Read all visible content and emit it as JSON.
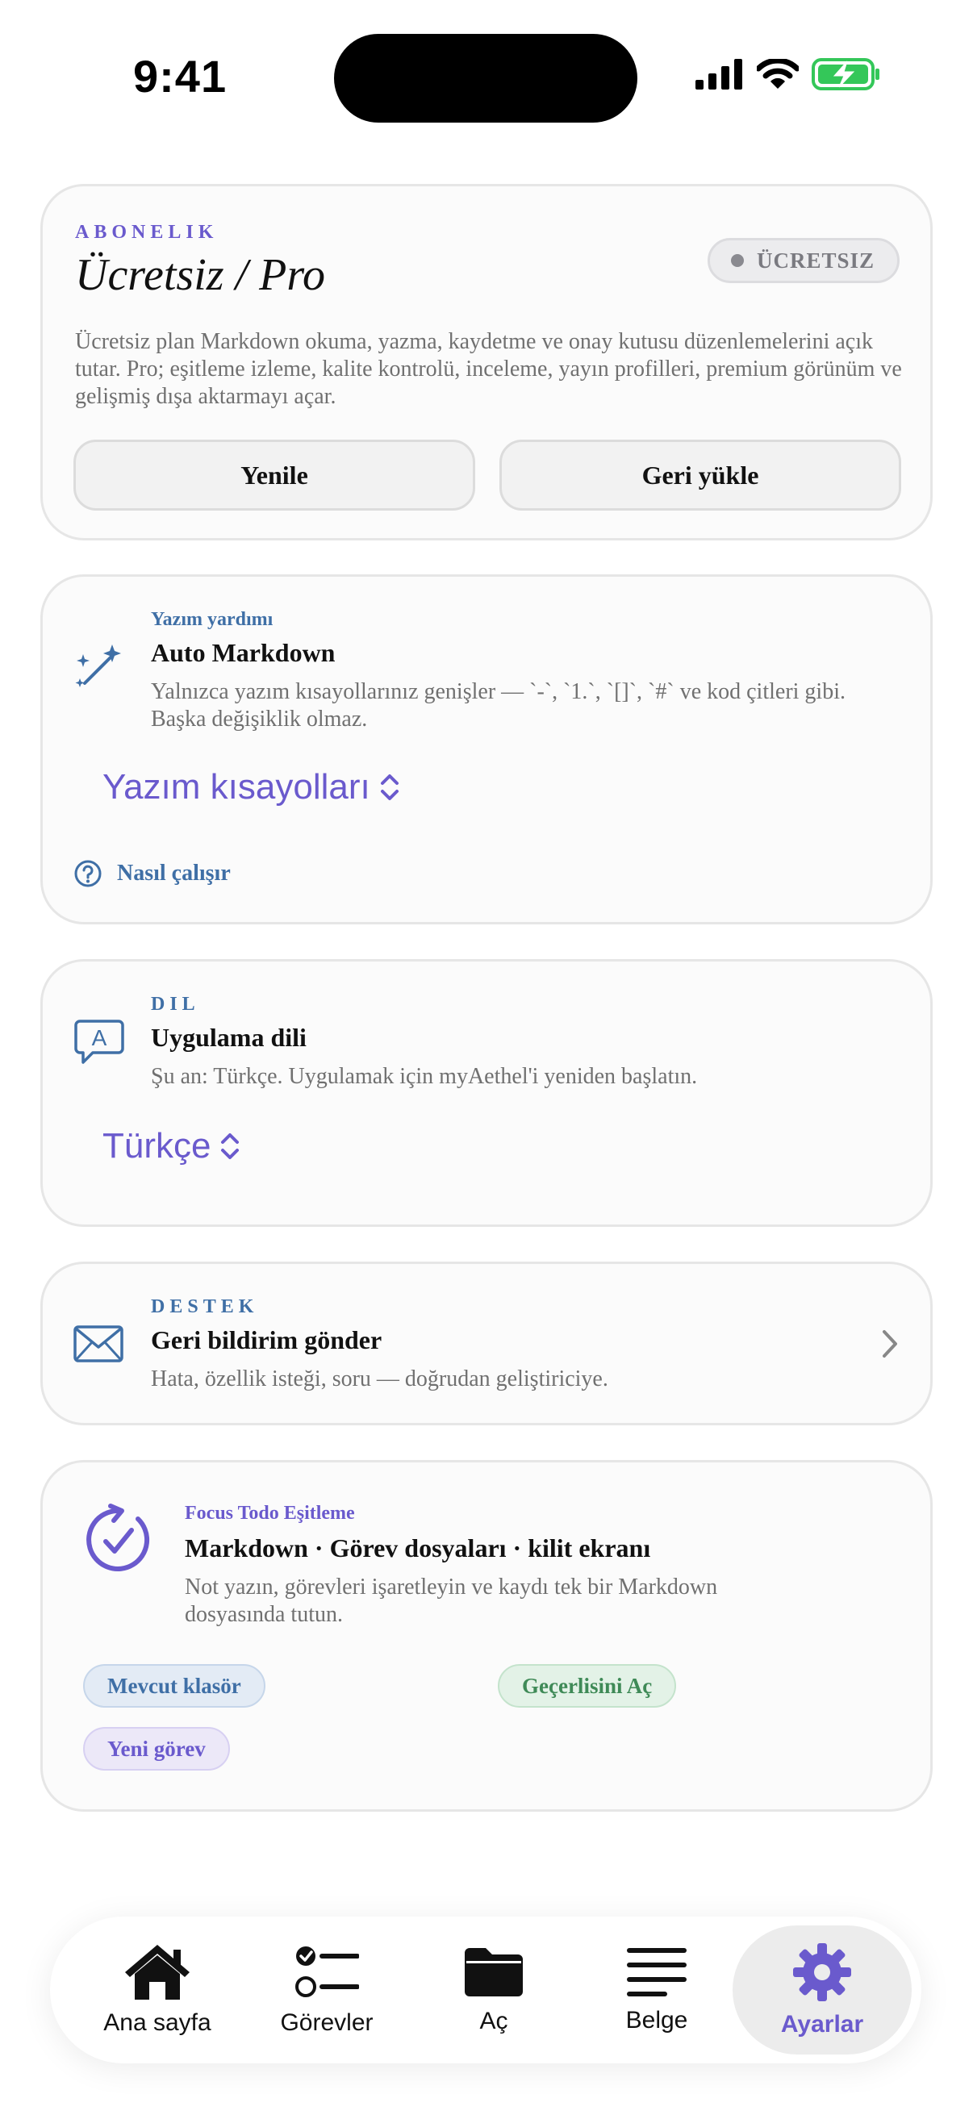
{
  "status_bar": {
    "time": "9:41",
    "icons": [
      "cellular-signal-icon",
      "wifi-icon",
      "battery-charging-icon"
    ]
  },
  "subscription": {
    "overline": "ABONELIK",
    "title": "Ücretsiz / Pro",
    "badge": "ÜCRETSIZ",
    "description": "Ücretsiz plan Markdown okuma, yazma, kaydetme ve onay kutusu düzenlemelerini açık tutar. Pro; eşitleme izleme, kalite kontrolü, inceleme, yayın profilleri, premium görünüm ve gelişmiş dışa aktarmayı açar.",
    "refresh_label": "Yenile",
    "restore_label": "Geri yükle"
  },
  "writing_assist": {
    "overline": "Yazım yardımı",
    "title": "Auto Markdown",
    "description": "Yalnızca yazım kısayollarınız genişler — `-`, `1.`, `[]`, `#` ve kod çitleri gibi. Başka değişiklik olmaz.",
    "picker_label": "Yazım kısayolları",
    "help_label": "Nasıl çalışır"
  },
  "language": {
    "overline": "DIL",
    "title": "Uygulama dili",
    "description": "Şu an: Türkçe. Uygulamak için myAethel'i yeniden başlatın.",
    "picker_label": "Türkçe"
  },
  "support": {
    "overline": "DESTEK",
    "title": "Geri bildirim gönder",
    "description": "Hata, özellik isteği, soru — doğrudan geliştiriciye."
  },
  "focus_todo": {
    "overline": "Focus Todo Eşitleme",
    "title": "Markdown · Görev dosyaları · kilit ekranı",
    "description": "Not yazın, görevleri işaretleyin ve kaydı tek bir Markdown dosyasında tutun.",
    "chips": [
      "Mevcut klasör",
      "Geçerlisini Aç",
      "Yeni görev"
    ]
  },
  "tabbar": {
    "tabs": [
      {
        "label": "Ana sayfa",
        "icon": "home-icon"
      },
      {
        "label": "Görevler",
        "icon": "checklist-icon"
      },
      {
        "label": "Aç",
        "icon": "folder-icon"
      },
      {
        "label": "Belge",
        "icon": "document-lines-icon"
      },
      {
        "label": "Ayarlar",
        "icon": "gear-icon"
      }
    ],
    "active": "Ayarlar"
  },
  "colors": {
    "accent": "#6a5acd",
    "blue": "#3f6fa6",
    "battery": "#34c759"
  }
}
